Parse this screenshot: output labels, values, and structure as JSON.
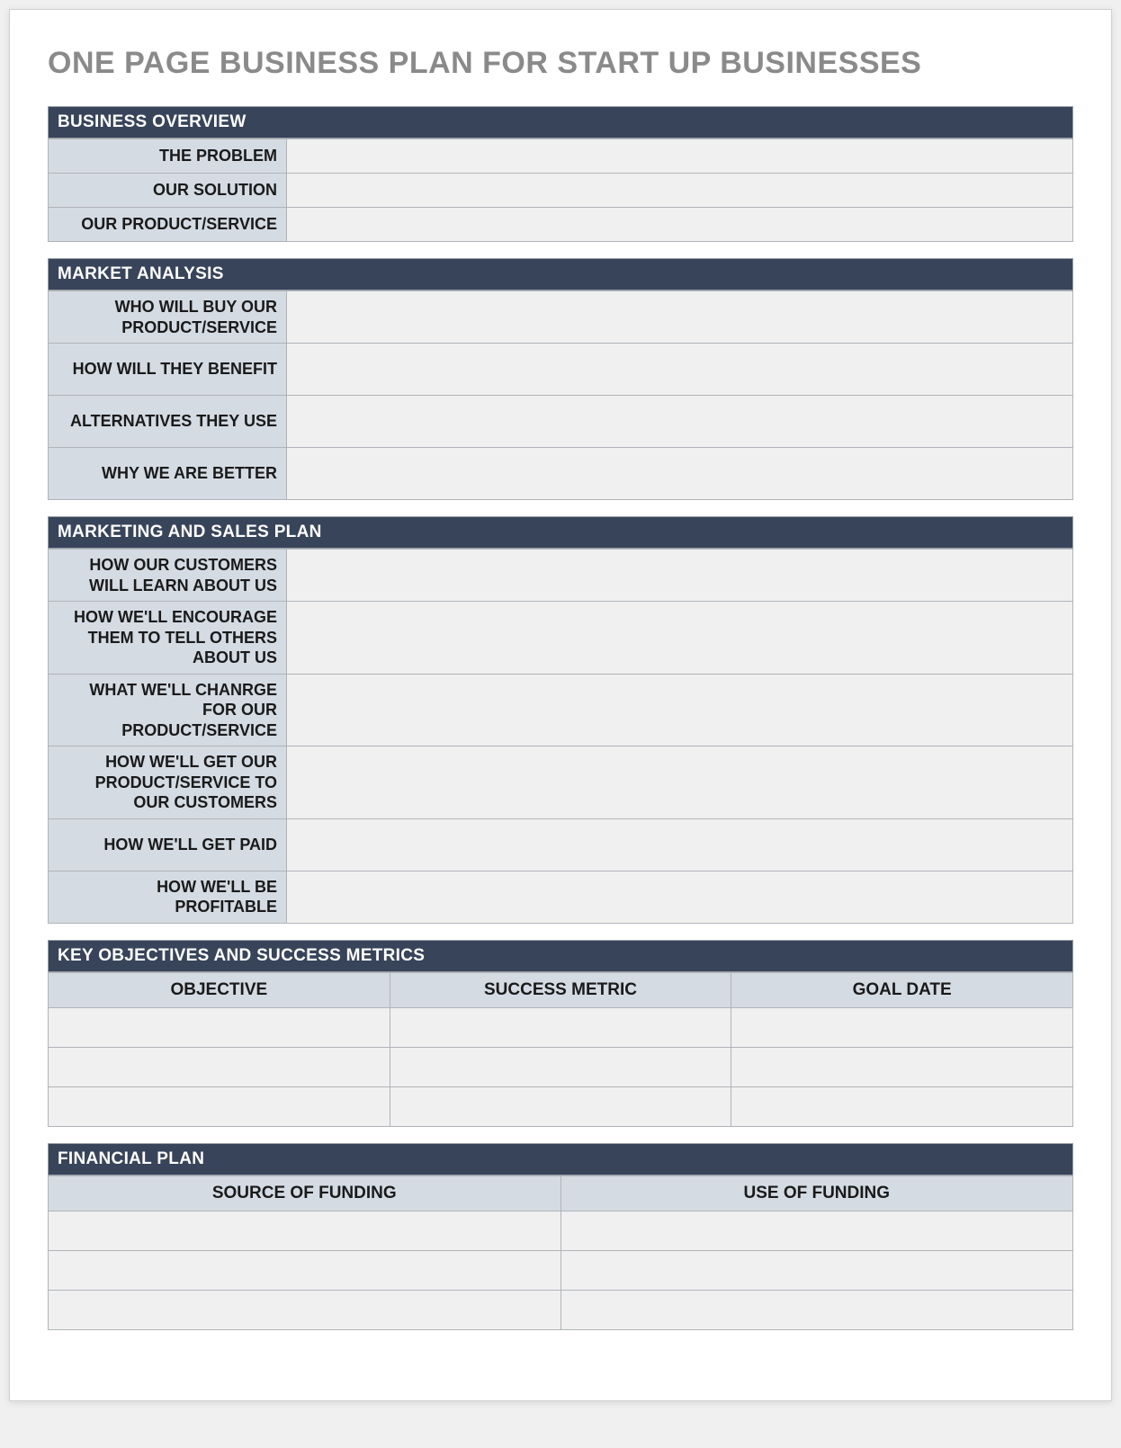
{
  "title": "ONE PAGE BUSINESS PLAN FOR START UP BUSINESSES",
  "sections": {
    "overview": {
      "header": "BUSINESS OVERVIEW",
      "rows": [
        {
          "label": "THE PROBLEM",
          "value": ""
        },
        {
          "label": "OUR SOLUTION",
          "value": ""
        },
        {
          "label": "OUR PRODUCT/SERVICE",
          "value": ""
        }
      ]
    },
    "market": {
      "header": "MARKET ANALYSIS",
      "rows": [
        {
          "label": "WHO WILL BUY OUR PRODUCT/SERVICE",
          "value": ""
        },
        {
          "label": "HOW WILL THEY BENEFIT",
          "value": ""
        },
        {
          "label": "ALTERNATIVES THEY USE",
          "value": ""
        },
        {
          "label": "WHY WE ARE BETTER",
          "value": ""
        }
      ]
    },
    "marketing": {
      "header": "MARKETING AND SALES PLAN",
      "rows": [
        {
          "label": "HOW OUR CUSTOMERS WILL LEARN ABOUT US",
          "value": ""
        },
        {
          "label": "HOW WE'LL ENCOURAGE THEM TO TELL OTHERS ABOUT US",
          "value": ""
        },
        {
          "label": "WHAT WE'LL CHANRGE FOR OUR PRODUCT/SERVICE",
          "value": ""
        },
        {
          "label": "HOW WE'LL GET OUR PRODUCT/SERVICE TO OUR CUSTOMERS",
          "value": ""
        },
        {
          "label": "HOW WE'LL GET PAID",
          "value": ""
        },
        {
          "label": "HOW WE'LL BE PROFITABLE",
          "value": ""
        }
      ]
    },
    "objectives": {
      "header": "KEY OBJECTIVES AND SUCCESS METRICS",
      "columns": [
        "OBJECTIVE",
        "SUCCESS METRIC",
        "GOAL DATE"
      ],
      "rows": [
        [
          "",
          "",
          ""
        ],
        [
          "",
          "",
          ""
        ],
        [
          "",
          "",
          ""
        ]
      ]
    },
    "financial": {
      "header": "FINANCIAL PLAN",
      "columns": [
        "SOURCE OF FUNDING",
        "USE OF FUNDING"
      ],
      "rows": [
        [
          "",
          ""
        ],
        [
          "",
          ""
        ],
        [
          "",
          ""
        ]
      ]
    }
  }
}
